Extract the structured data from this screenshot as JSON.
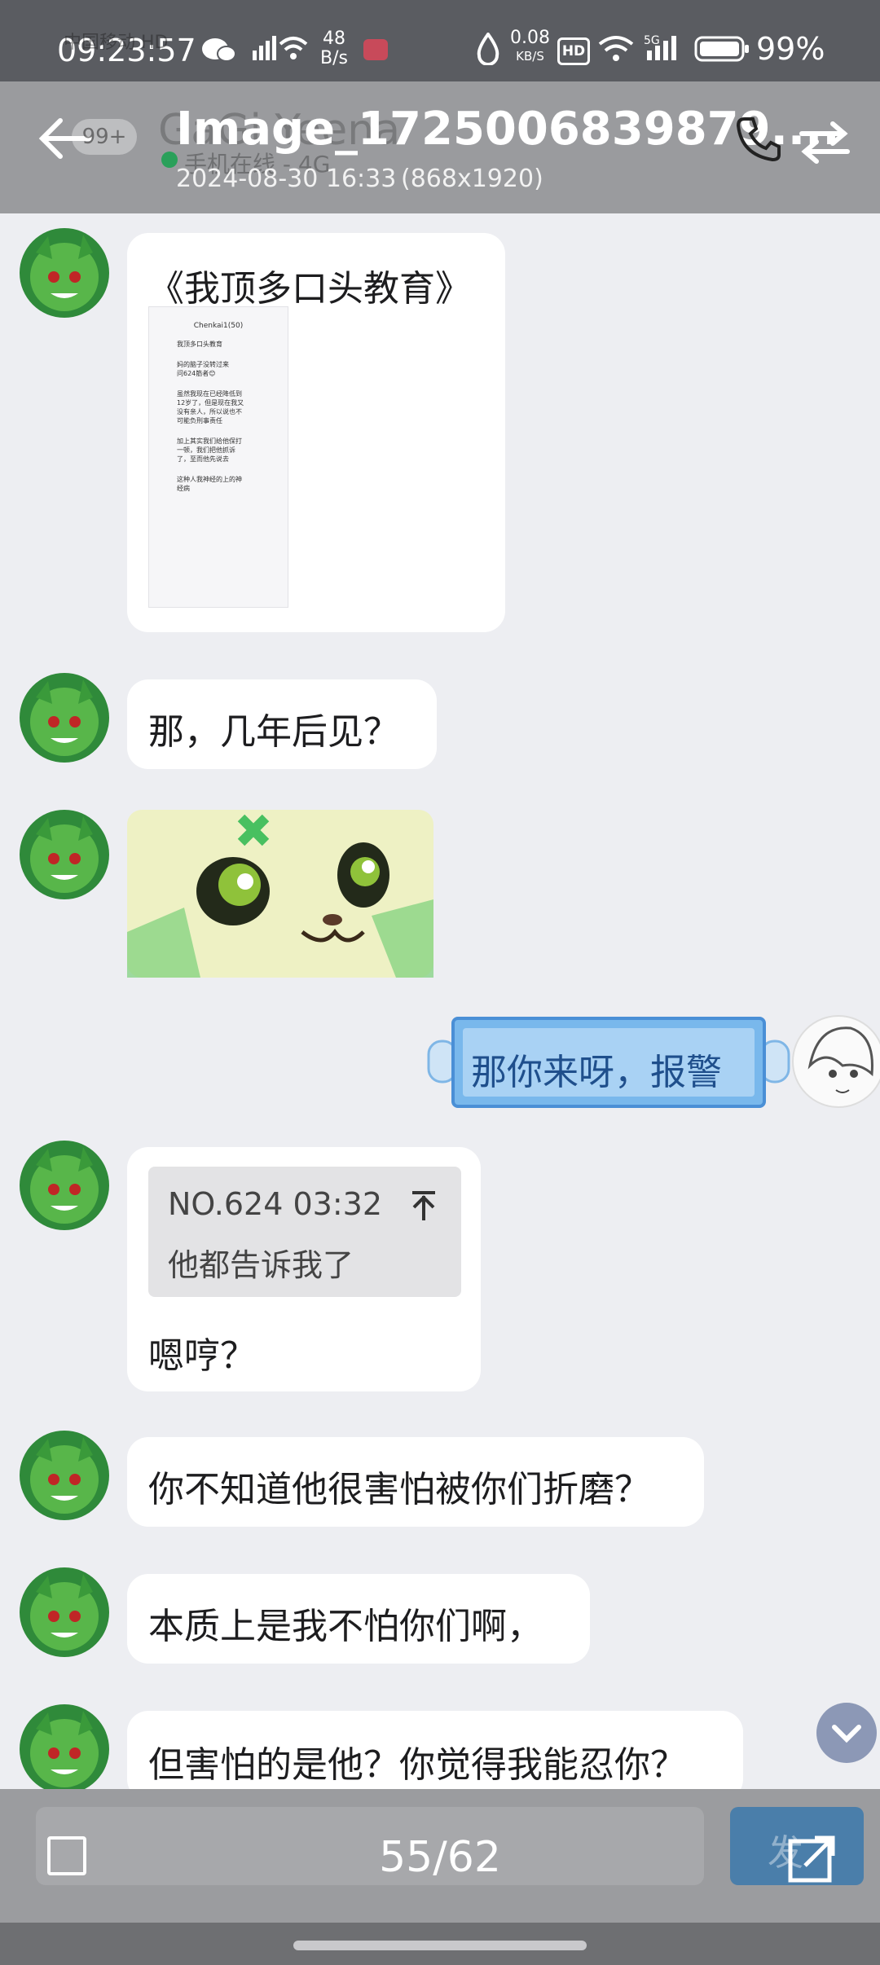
{
  "status_bar": {
    "time": "09:23:57",
    "carrier_ghost": "中国移动 HD",
    "net_speed": "48",
    "net_speed_unit": "B/s",
    "data_speed": "0.08",
    "data_unit": "KB/S",
    "hd": "HD",
    "battery": "99%"
  },
  "viewer": {
    "title": "Image_1725006839879....",
    "date": "2024-08-30 16:33",
    "resolution": "(868x1920)",
    "counter": "55/62",
    "badge": "99+",
    "chat_name_ghost": "GaGi Yeena",
    "chat_status_ghost": "手机在线 - 4G",
    "send_ghost": "发"
  },
  "messages": [
    {
      "text": "《我顶多口头教育》"
    },
    {
      "text": "那，几年后见？"
    },
    {
      "text": "那你来呀，报警"
    },
    {
      "quote_header": "NO.624 03:32",
      "quote_text": "他都告诉我了",
      "text": "嗯哼？"
    },
    {
      "text": "你不知道他很害怕被你们折磨？"
    },
    {
      "text": "本质上是我不怕你们啊，"
    },
    {
      "text": "但害怕的是他？你觉得我能忍你？"
    }
  ],
  "embedded_screenshot": {
    "title": "Chenkai1(50)",
    "lines": [
      "我顶多口头教育",
      "妈的脑子没转过来",
      "问624筋者😊",
      "虽然我现在已经降低到",
      "12岁了，但是现在我又",
      "没有亲人，所以说也不",
      "可能负刑事责任",
      "加上其实我们给他保打",
      "一顿，我们把他抓诉",
      "了，至而他先说去",
      "这种人我神经的上的神",
      "经病"
    ]
  },
  "colors": {
    "accent": "#4a8fd6",
    "status_bar": "#5a5c61",
    "overlay": "#9a9b9e",
    "chat_bg": "#edeef2"
  }
}
